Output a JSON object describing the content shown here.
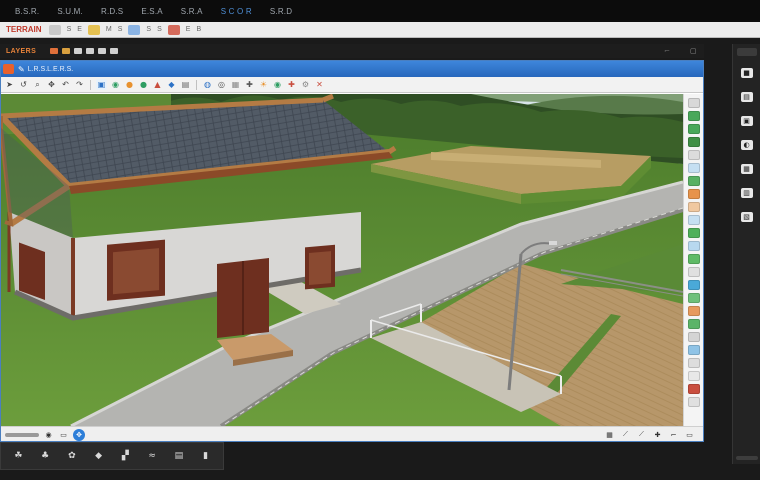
{
  "menubar": {
    "items": [
      "B.S.R.",
      "S.U.M.",
      "R.D.S",
      "E.S.A",
      "S.R.A",
      "S C O R",
      "S.R.D"
    ],
    "accent_index": 5
  },
  "strip": {
    "title": "TERRAIN",
    "items": [
      "S",
      "E",
      "M",
      "S",
      "S",
      "S",
      "E",
      "B"
    ]
  },
  "layerbar": {
    "tag": "LAYERS"
  },
  "window": {
    "title_text": "L.R.S.L.E.R.S."
  },
  "toolbar": {
    "icons": [
      "select-icon",
      "rotate-icon",
      "zoom-icon",
      "pan-icon",
      "undo-icon",
      "redo-icon",
      "move-icon",
      "scale-icon",
      "brush-icon",
      "paint-icon",
      "terrain-icon",
      "water-icon",
      "road-icon",
      "fence-icon",
      "tree-icon",
      "grass-icon",
      "rock-icon",
      "light-icon",
      "camera-icon",
      "render-icon",
      "settings-icon",
      "help-icon"
    ]
  },
  "colors": {
    "title_blue": "#2d72c6",
    "accent_orange": "#e8612c",
    "grass": "#5e8f33",
    "roof": "#4d5560",
    "road": "#b3b4b2",
    "field": "#b89a67",
    "canvas_bg": "#161616"
  },
  "statusbar": {
    "right_icons": [
      "grid-icon",
      "snap-icon",
      "measure-icon",
      "pin-icon",
      "lock-icon",
      "expand-icon"
    ]
  },
  "dock": {
    "items": [
      "tree-icon",
      "shrub-icon",
      "flower-icon",
      "rock-icon",
      "path-icon",
      "water-icon",
      "bench-icon",
      "lamp-icon"
    ]
  },
  "rpanel": {
    "items": [
      "materials-icon",
      "layers-icon",
      "objects-icon",
      "lights-icon",
      "textures-icon",
      "export-icon",
      "settings-icon"
    ]
  }
}
